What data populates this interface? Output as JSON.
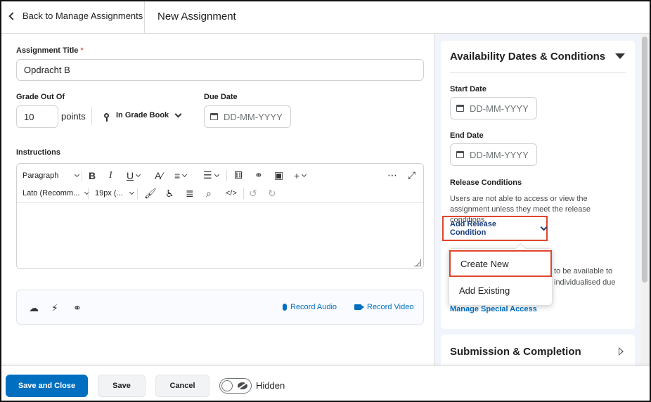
{
  "header": {
    "back_label": "Back to Manage Assignments",
    "title": "New Assignment"
  },
  "form": {
    "title_label": "Assignment Title",
    "required_mark": "*",
    "title_value": "Opdracht B",
    "grade_label": "Grade Out Of",
    "grade_value": "10",
    "points_label": "points",
    "gradebook_label": "In Grade Book",
    "due_label": "Due Date",
    "due_placeholder": "DD-MM-YYYY",
    "instructions_label": "Instructions"
  },
  "editor": {
    "paragraph_label": "Paragraph",
    "font_label": "Lato (Recomm...",
    "size_label": "19px (..."
  },
  "attachments": {
    "record_audio": "Record Audio",
    "record_video": "Record Video"
  },
  "sidebar": {
    "availability_title": "Availability Dates & Conditions",
    "start_label": "Start Date",
    "start_placeholder": "DD-MM-YYYY",
    "end_label": "End Date",
    "end_placeholder": "DD-MM-YYYY",
    "release_label": "Release Conditions",
    "release_desc": "Users are not able to access or view the assignment unless they meet the release conditions.",
    "add_release_label": "Add Release Condition",
    "hidden_line1": "to be available to",
    "hidden_line2": "individualised due",
    "special_access_link": "Manage Special Access",
    "submission_title": "Submission & Completion"
  },
  "dropdown": {
    "create_new": "Create New",
    "add_existing": "Add Existing"
  },
  "footer": {
    "save_close": "Save and Close",
    "save": "Save",
    "cancel": "Cancel",
    "visibility_label": "Hidden"
  },
  "colors": {
    "primary": "#006fbf",
    "highlight": "#e0452c",
    "link": "#006fbf"
  }
}
